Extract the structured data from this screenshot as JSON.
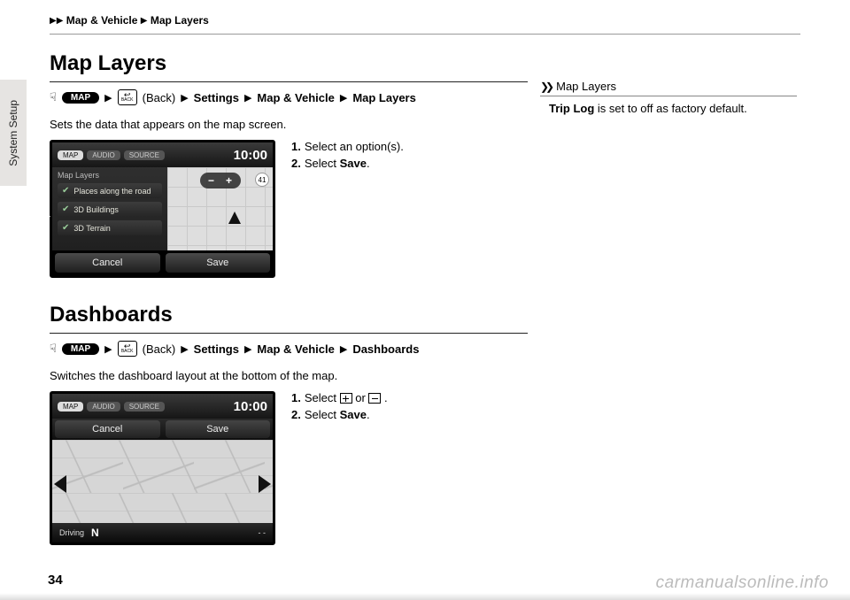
{
  "breadcrumb": {
    "a": "Map & Vehicle",
    "b": "Map Layers"
  },
  "side_tab": "System Setup",
  "sec1": {
    "title": "Map Layers",
    "nav": {
      "map": "MAP",
      "back_word": "(Back)",
      "settings": "Settings",
      "mv": "Map & Vehicle",
      "last": "Map Layers",
      "back_key": "BACK"
    },
    "intro": "Sets the data that appears on the map screen.",
    "device": {
      "tabs": {
        "map": "MAP",
        "audio": "AUDIO",
        "source": "SOURCE"
      },
      "clock": "10:00",
      "panel_title": "Map Layers",
      "items": [
        "Places along the road",
        "3D Buildings",
        "3D Terrain"
      ],
      "speed": "41",
      "cancel": "Cancel",
      "save": "Save"
    },
    "steps": {
      "s1a": "Select an option(s).",
      "s2a": "Select ",
      "s2b": "Save",
      "s2c": "."
    }
  },
  "sec2": {
    "title": "Dashboards",
    "nav": {
      "map": "MAP",
      "back_word": "(Back)",
      "settings": "Settings",
      "mv": "Map & Vehicle",
      "last": "Dashboards",
      "back_key": "BACK"
    },
    "intro": "Switches the dashboard layout at the bottom of the map.",
    "device": {
      "tabs": {
        "map": "MAP",
        "audio": "AUDIO",
        "source": "SOURCE"
      },
      "clock": "10:00",
      "cancel": "Cancel",
      "save": "Save",
      "dash_label": "Driving",
      "dash_heading": "N",
      "dash_right": "- -"
    },
    "steps": {
      "s1a": "Select ",
      "s1b": " or ",
      "s1c": ".",
      "s2a": "Select ",
      "s2b": "Save",
      "s2c": "."
    }
  },
  "tip": {
    "head": "Map Layers",
    "body_a": "Trip Log",
    "body_b": " is set to off as factory default."
  },
  "pagenum": "34",
  "watermark": "carmanualsonline.info"
}
